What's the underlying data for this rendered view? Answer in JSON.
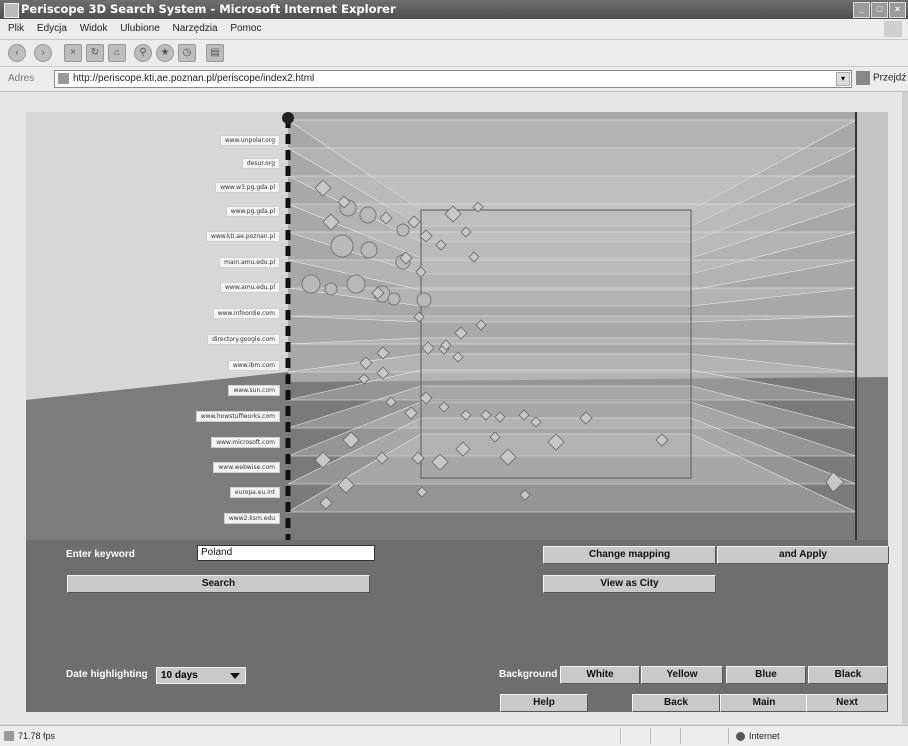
{
  "window": {
    "title": "Periscope 3D Search System - Microsoft Internet Explorer"
  },
  "menu": {
    "items": [
      "Plik",
      "Edycja",
      "Widok",
      "Ulubione",
      "Narzędzia",
      "Pomoc"
    ]
  },
  "toolbar": {
    "icons": [
      "back-icon",
      "forward-icon",
      "stop-icon",
      "refresh-icon",
      "home-icon",
      "search-icon",
      "favorites-icon",
      "print-icon"
    ]
  },
  "address": {
    "label": "Adres",
    "url": "http://periscope.kti.ae.poznan.pl/periscope/index2.html",
    "go_label": "Przejdź"
  },
  "scene": {
    "url_labels": [
      "www.unpolar.org",
      "desur.org",
      "www.w3.pg.gda.pl",
      "www.pg.gda.pl",
      "www.kti.ae.poznan.pl",
      "main.amu.edu.pl",
      "www.amu.edu.pl",
      "www.infoordie.com",
      "directory.google.com",
      "www.ibm.com",
      "www.sun.com",
      "www.howstuffworks.com",
      "www.microsoft.com",
      "www.webwise.com",
      "europa.eu.int",
      "www2.ksm.edu"
    ]
  },
  "panel": {
    "keyword_label": "Enter keyword",
    "keyword_value": "Poland",
    "search_label": "Search",
    "change_mapping_label": "Change mapping",
    "apply_label": "and Apply",
    "view_city_label": "View as City",
    "date_label": "Date highlighting",
    "date_value": "10 days",
    "background_label": "Background",
    "bg_options": [
      "White",
      "Yellow",
      "Blue",
      "Black"
    ],
    "help_label": "Help",
    "back_label": "Back",
    "main_label": "Main",
    "next_label": "Next"
  },
  "status": {
    "fps": "71.78 fps",
    "zone": "Internet"
  }
}
